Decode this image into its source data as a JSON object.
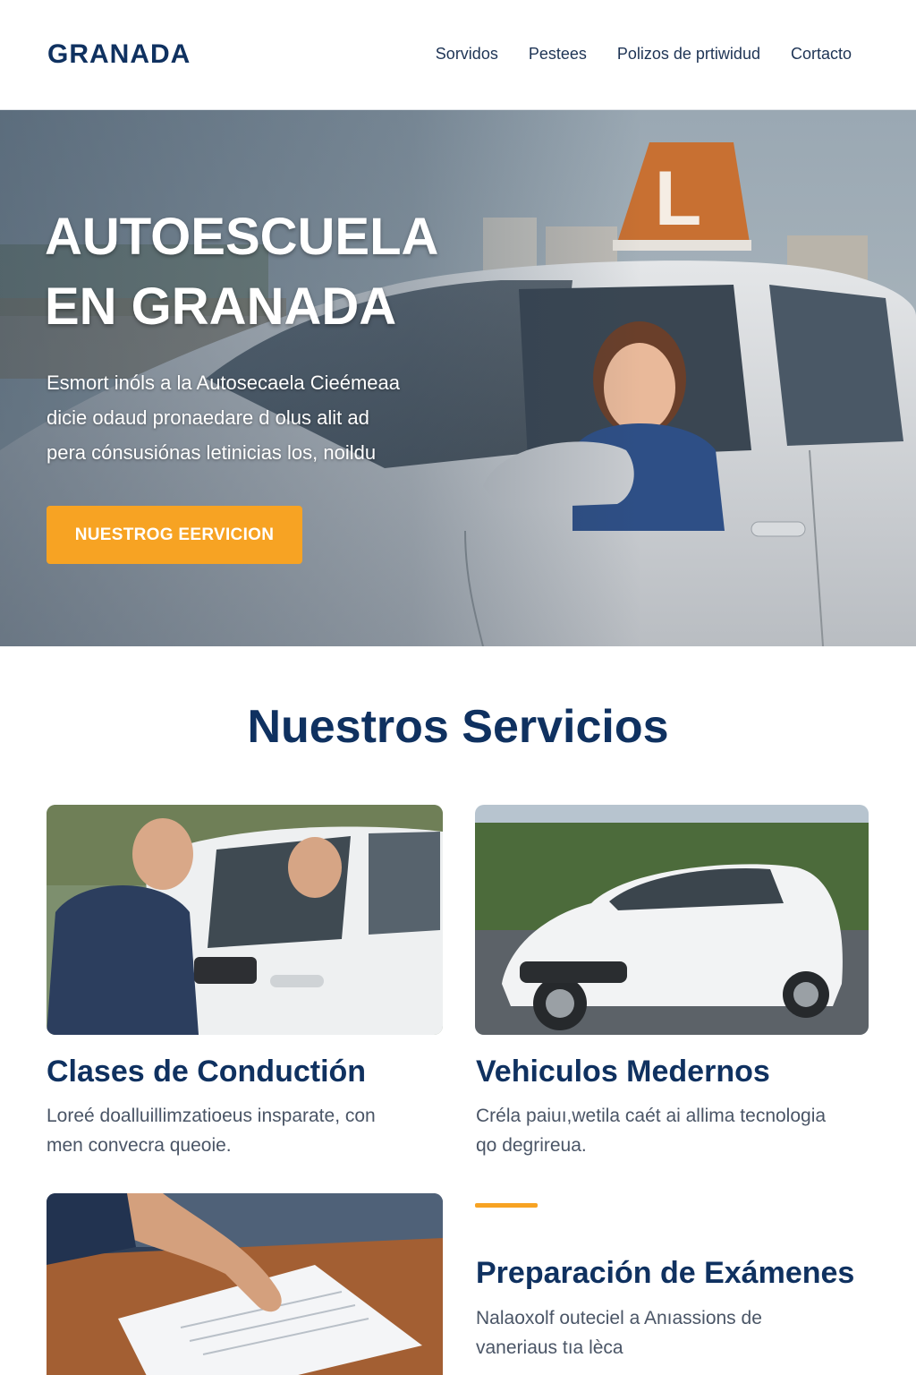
{
  "header": {
    "logo": "GRANADA",
    "nav": [
      "Sorvidos",
      "Pestees",
      "Polizos de prtiwidud",
      "Cortacto"
    ]
  },
  "hero": {
    "title_line1": "AUTOESCUELA",
    "title_line2": "EN GRANADA",
    "text_line1": "Esmort inóls a la Autosecaela Cieémeaa",
    "text_line2": "dicie odaud pronaedare d olus alit ad",
    "text_line3": "pera cónsusiónas letinicias los, noildu",
    "button": "NUESTROG EERVICION",
    "sign_letter": "L"
  },
  "services": {
    "title": "Nuestros Servicios",
    "cards": [
      {
        "title": "Clases de Conductión",
        "text_line1": "Loreé doalluillimzatioeus insparate, con",
        "text_line2": "men convecra queoie."
      },
      {
        "title": "Vehiculos Medernos",
        "text_line1": "Créla paiuı,wetila caét ai allima tecnologia",
        "text_line2": "qo degrireua."
      },
      {
        "title": "Preparación de Exámenes",
        "text_line1": "Nalaoxolf outeciel a Anıassions de",
        "text_line2": "vaneriaus tıa lèca"
      }
    ]
  },
  "colors": {
    "brand_navy": "#0f3160",
    "accent_orange": "#f7a323"
  }
}
